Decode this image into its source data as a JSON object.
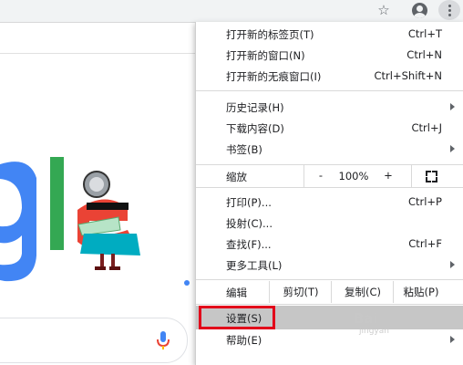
{
  "menu": {
    "items_top": [
      {
        "label": "打开新的标签页(T)",
        "shortcut": "Ctrl+T"
      },
      {
        "label": "打开新的窗口(N)",
        "shortcut": "Ctrl+N"
      },
      {
        "label": "打开新的无痕窗口(I)",
        "shortcut": "Ctrl+Shift+N"
      }
    ],
    "history": {
      "label": "历史记录(H)"
    },
    "downloads": {
      "label": "下载内容(D)",
      "shortcut": "Ctrl+J"
    },
    "bookmarks": {
      "label": "书签(B)"
    },
    "zoom": {
      "label": "缩放",
      "minus": "-",
      "value": "100%",
      "plus": "+"
    },
    "print": {
      "label": "打印(P)...",
      "shortcut": "Ctrl+P"
    },
    "cast": {
      "label": "投射(C)..."
    },
    "find": {
      "label": "查找(F)...",
      "shortcut": "Ctrl+F"
    },
    "more_tools": {
      "label": "更多工具(L)"
    },
    "edit": {
      "label": "编辑",
      "cut": "剪切(T)",
      "copy": "复制(C)",
      "paste": "粘贴(P)"
    },
    "settings": {
      "label": "设置(S)"
    },
    "help": {
      "label": "帮助(E)"
    }
  },
  "watermark": {
    "text": "Bai",
    "sub": "jingyan"
  },
  "colors": {
    "highlight": "#c6c6c6",
    "annotation_box": "#e2001a",
    "google_blue": "#4285f4",
    "google_green": "#34a853"
  }
}
